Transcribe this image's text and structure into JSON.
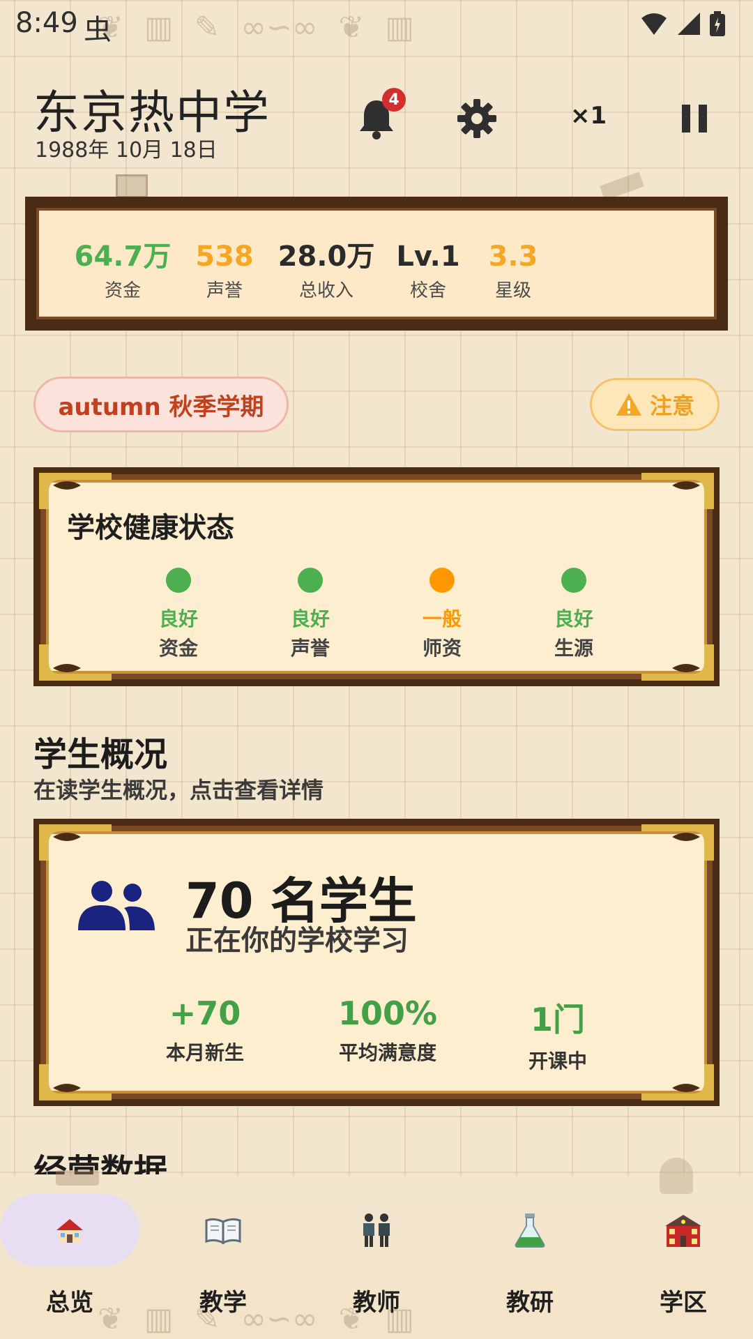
{
  "status_bar": {
    "time": "8:49",
    "glyph": "虫"
  },
  "header": {
    "school_name": "东京热中学",
    "date": "1988年 10月 18日",
    "notification_count": "4",
    "speed": "×1"
  },
  "stats": [
    {
      "value": "64.7万",
      "label": "资金",
      "color": "#4caf50"
    },
    {
      "value": "538",
      "label": "声誉",
      "color": "#f5a623"
    },
    {
      "value": "28.0万",
      "label": "总收入",
      "color": "#2b2b2b"
    },
    {
      "value": "Lv.1",
      "label": "校舍",
      "color": "#2b2b2b"
    },
    {
      "value": "3.3",
      "label": "星级",
      "color": "#f5a623"
    }
  ],
  "season": {
    "label": "autumn 秋季学期"
  },
  "notice": {
    "label": "注意"
  },
  "health": {
    "title": "学校健康状态",
    "items": [
      {
        "status": "良好",
        "label": "资金",
        "color": "#4caf50"
      },
      {
        "status": "良好",
        "label": "声誉",
        "color": "#4caf50"
      },
      {
        "status": "一般",
        "label": "师资",
        "color": "#ff9800"
      },
      {
        "status": "良好",
        "label": "生源",
        "color": "#4caf50"
      }
    ]
  },
  "students_section": {
    "title": "学生概况",
    "subtitle": "在读学生概况，点击查看详情",
    "count": "70 名学生",
    "description": "正在你的学校学习",
    "metrics": [
      {
        "value": "+70",
        "label": "本月新生"
      },
      {
        "value": "100%",
        "label": "平均满意度"
      },
      {
        "value": "1门",
        "label": "开课中"
      }
    ]
  },
  "next_section": {
    "title": "经营数据"
  },
  "nav": {
    "items": [
      {
        "label": "总览",
        "icon": "house-icon",
        "active": true
      },
      {
        "label": "教学",
        "icon": "book-icon",
        "active": false
      },
      {
        "label": "教师",
        "icon": "teachers-icon",
        "active": false
      },
      {
        "label": "教研",
        "icon": "flask-icon",
        "active": false
      },
      {
        "label": "学区",
        "icon": "school-building-icon",
        "active": false
      }
    ]
  },
  "colors": {
    "frame_dark": "#4a2c14",
    "accent_green": "#4caf50",
    "accent_orange": "#ff9800",
    "accent_red": "#d32f2f"
  }
}
